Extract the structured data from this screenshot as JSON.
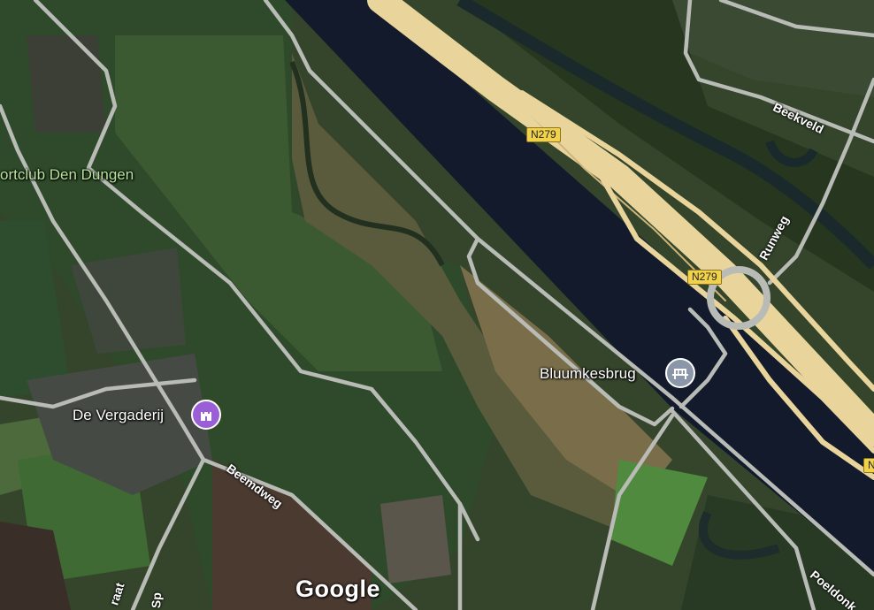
{
  "map": {
    "imagery": "satellite",
    "colors": {
      "field_dark": "#2a3a23",
      "field_mid": "#3b5230",
      "field_light": "#55703f",
      "canal": "#111a2b",
      "road_white": "#b9bcb6",
      "highway": "#e9d59c",
      "place_pin": "#9a5fd6",
      "bridge_pin": "#8b96a8"
    }
  },
  "labels": {
    "sportclub": "ortclub Den Dungen",
    "vergaderij": "De Vergaderij",
    "bluumkesbrug": "Bluumkesbrug"
  },
  "roads": {
    "beekveld": "Beekveld",
    "runweg": "Runweg",
    "beemdweg": "Beemdweg",
    "poeldonk": "Poeldonk",
    "partial_left": "raat",
    "partial_sp": "Sp"
  },
  "shields": {
    "n279_top": "N279",
    "n279_mid": "N279",
    "n279_edge": "N"
  },
  "icons": {
    "place_pin": "castle-icon",
    "bridge_pin": "bridge-icon"
  },
  "attribution": {
    "logo": "Google"
  }
}
